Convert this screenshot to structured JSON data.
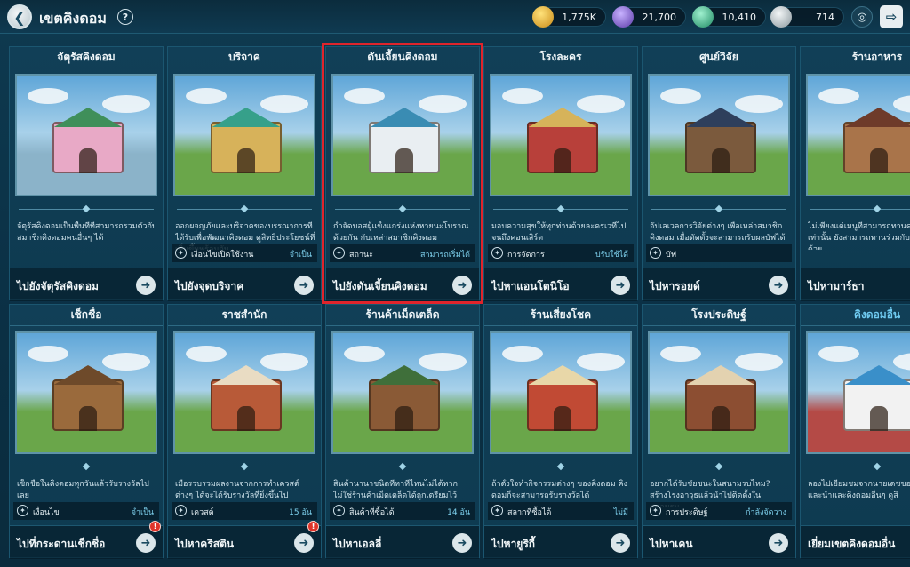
{
  "header": {
    "title": "เขตคิงดอม",
    "back_icon": "back-arrow-icon",
    "help_label": "?",
    "currencies": [
      {
        "icon": "gold-coin-icon",
        "value": "1,775K",
        "color": "#e9b73a"
      },
      {
        "icon": "crystal-icon",
        "value": "21,700",
        "color": "#8d6ad8"
      },
      {
        "icon": "gem-icon",
        "value": "10,410",
        "color": "#3dbb8a"
      },
      {
        "icon": "silver-orb-icon",
        "value": "714",
        "color": "#b8c4ca"
      }
    ],
    "settings_icon": "target-icon",
    "exit_icon": "exit-door-icon"
  },
  "cards": [
    {
      "title": "จัตุรัสคิงดอม",
      "desc": "จัตุรัสคิงดอมเป็นพื้นที่ที่สามารถรวมตัวกับสมาชิกคิงดอมคนอื่นๆ ได้",
      "status": null,
      "footer": "ไปยังจัตุรัสคิงดอม",
      "badge": false,
      "accent": false,
      "selected": false
    },
    {
      "title": "บริจาค",
      "desc": "ออกผจญภัยและบริจาคของบรรณาการที่ได้รับเพื่อพัฒนาคิงดอม ดูสิทธิประโยชน์ที่เพิ่มขึ้นพร้อมกัน",
      "status": {
        "label": "เงื่อนไขเปิดใช้งาน",
        "value": "จำเป็น"
      },
      "footer": "ไปยังจุดบริจาค",
      "badge": false,
      "accent": false,
      "selected": false
    },
    {
      "title": "ดันเจี้ยนคิงดอม",
      "desc": "กำจัดบอสผู้แข็งแกร่งแห่งหายนะโบราณด้วยกัน กับเหล่าสมาชิกคิงดอม",
      "status": {
        "label": "สถานะ",
        "value": "สามารถเริ่มได้"
      },
      "footer": "ไปยังดันเจี้ยนคิงดอม",
      "badge": false,
      "accent": false,
      "selected": true
    },
    {
      "title": "โรงละคร",
      "desc": "มอบความสุขให้ทุกท่านด้วยละครเวทีไปจนถึงคอนเสิร์ต",
      "status": {
        "label": "การจัดการ",
        "value": "ปรับใช้ได้"
      },
      "footer": "ไปหาแอนโตนิโอ",
      "badge": false,
      "accent": false,
      "selected": false
    },
    {
      "title": "ศูนย์วิจัย",
      "desc": "อัปเลเวลการวิจัยต่างๆ เพื่อเหล่าสมาชิกคิงดอม เมื่อตัดตั้งจะสามารถรับผลบัฟได้",
      "status": {
        "label": "บัฟ",
        "value": ""
      },
      "footer": "ไปหารอยด์",
      "badge": false,
      "accent": false,
      "selected": false
    },
    {
      "title": "ร้านอาหาร",
      "desc": "ไม่เพียงแต่เมนูที่สามารถทานคนเดียวได้เท่านั้น ยังสามารถทานร่วมกับสมาชิกได้ด้วย",
      "status": null,
      "footer": "ไปหามาร์ธา",
      "badge": false,
      "accent": false,
      "selected": false
    },
    {
      "title": "เช็กชื่อ",
      "desc": "เช็กชื่อในคิงดอมทุกวันแล้วรับรางวัลไปเลย",
      "status": {
        "label": "เงื่อนไข",
        "value": "จำเป็น"
      },
      "footer": "ไปที่กระดานเช็กชื่อ",
      "badge": true,
      "accent": false,
      "selected": false
    },
    {
      "title": "ราชสำนัก",
      "desc": "เมื่อรวบรวมผลงานจากการทำเควสต์ ต่างๆ ได้จะได้รับรางวัลที่ยิ่งขึ้นไป",
      "status": {
        "label": "เควสต์",
        "value": "15 อัน"
      },
      "footer": "ไปหาคริสติน",
      "badge": true,
      "accent": false,
      "selected": false
    },
    {
      "title": "ร้านค้าเม็ดเตล็ด",
      "desc": "สินค้านานาชนิดที่หาที่ไหนไม่ได้หากไม่ใช่ร้านค้าเม็ดเตล็ดได้ถูกเตรียมไว้",
      "status": {
        "label": "สินค้าที่ซื้อได้",
        "value": "14 อัน"
      },
      "footer": "ไปหาเอลลี่",
      "badge": false,
      "accent": false,
      "selected": false
    },
    {
      "title": "ร้านเสี่ยงโชค",
      "desc": "ถ้าตั้งใจทำกิจกรรมต่างๆ ของคิงดอม คิงดอมก็จะสามารถรับรางวัลได้",
      "status": {
        "label": "สลากที่ซื้อได้",
        "value": "ไม่มี"
      },
      "footer": "ไปหายูริกี้",
      "badge": false,
      "accent": false,
      "selected": false
    },
    {
      "title": "โรงประดิษฐ์",
      "desc": "อยากได้รับชัยชนะในสนามรบไหม? สร้างโรงอาวุธแล้วนำไปติดตั้งในสนามรบ",
      "status": {
        "label": "การประดิษฐ์",
        "value": "กำลังจัดวาง"
      },
      "footer": "ไปหาเคน",
      "badge": false,
      "accent": false,
      "selected": false
    },
    {
      "title": "คิงดอมอื่น",
      "desc": "ลองไปเยี่ยมชมจากนายเดชของคิงดอมที่และนำและคิงดอมอื่นๆ ดูสิ",
      "status": null,
      "footer": "เยี่ยมเขตคิงดอมอื่น",
      "badge": false,
      "accent": true,
      "selected": false
    }
  ]
}
